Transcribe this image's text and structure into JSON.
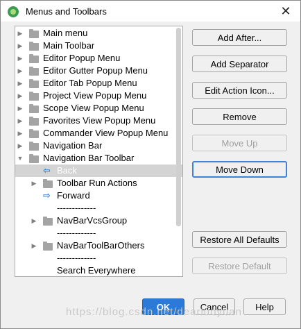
{
  "window": {
    "title": "Menus and Toolbars",
    "close_glyph": "✕"
  },
  "tree": {
    "rows": [
      {
        "label": "Main menu",
        "kind": "folder",
        "expanded": false,
        "level": 0
      },
      {
        "label": "Main Toolbar",
        "kind": "folder",
        "expanded": false,
        "level": 0
      },
      {
        "label": "Editor Popup Menu",
        "kind": "folder",
        "expanded": false,
        "level": 0
      },
      {
        "label": "Editor Gutter Popup Menu",
        "kind": "folder",
        "expanded": false,
        "level": 0
      },
      {
        "label": "Editor Tab Popup Menu",
        "kind": "folder",
        "expanded": false,
        "level": 0
      },
      {
        "label": "Project View Popup Menu",
        "kind": "folder",
        "expanded": false,
        "level": 0
      },
      {
        "label": "Scope View Popup Menu",
        "kind": "folder",
        "expanded": false,
        "level": 0
      },
      {
        "label": "Favorites View Popup Menu",
        "kind": "folder",
        "expanded": false,
        "level": 0
      },
      {
        "label": "Commander View Popup Menu",
        "kind": "folder",
        "expanded": false,
        "level": 0
      },
      {
        "label": "Navigation Bar",
        "kind": "folder",
        "expanded": false,
        "level": 0
      },
      {
        "label": "Navigation Bar Toolbar",
        "kind": "folder",
        "expanded": true,
        "level": 0
      },
      {
        "label": "Back",
        "kind": "action-back",
        "level": 1,
        "selected": true
      },
      {
        "label": "Toolbar Run Actions",
        "kind": "folder",
        "expanded": false,
        "level": 1
      },
      {
        "label": "Forward",
        "kind": "action-forward",
        "level": 1
      },
      {
        "label": "-------------",
        "kind": "separator",
        "level": 1
      },
      {
        "label": "NavBarVcsGroup",
        "kind": "folder",
        "expanded": false,
        "level": 1
      },
      {
        "label": "-------------",
        "kind": "separator",
        "level": 1
      },
      {
        "label": "NavBarToolBarOthers",
        "kind": "folder",
        "expanded": false,
        "level": 1
      },
      {
        "label": "-------------",
        "kind": "separator",
        "level": 1
      },
      {
        "label": "Search Everywhere",
        "kind": "action",
        "level": 1
      }
    ]
  },
  "actions": {
    "add_after": "Add After...",
    "add_separator": "Add Separator",
    "edit_action_icon": "Edit Action Icon...",
    "remove": "Remove",
    "move_up": "Move Up",
    "move_down": "Move Down",
    "restore_all_defaults": "Restore All Defaults",
    "restore_default": "Restore Default"
  },
  "footer": {
    "ok": "OK",
    "cancel": "Cancel",
    "help": "Help"
  },
  "watermark": "https://blog.csdn.net/dearluoyuan",
  "colors": {
    "accent": "#2b7ad8",
    "selection": "#d4d4d4",
    "focus_border": "#3e83d8"
  }
}
